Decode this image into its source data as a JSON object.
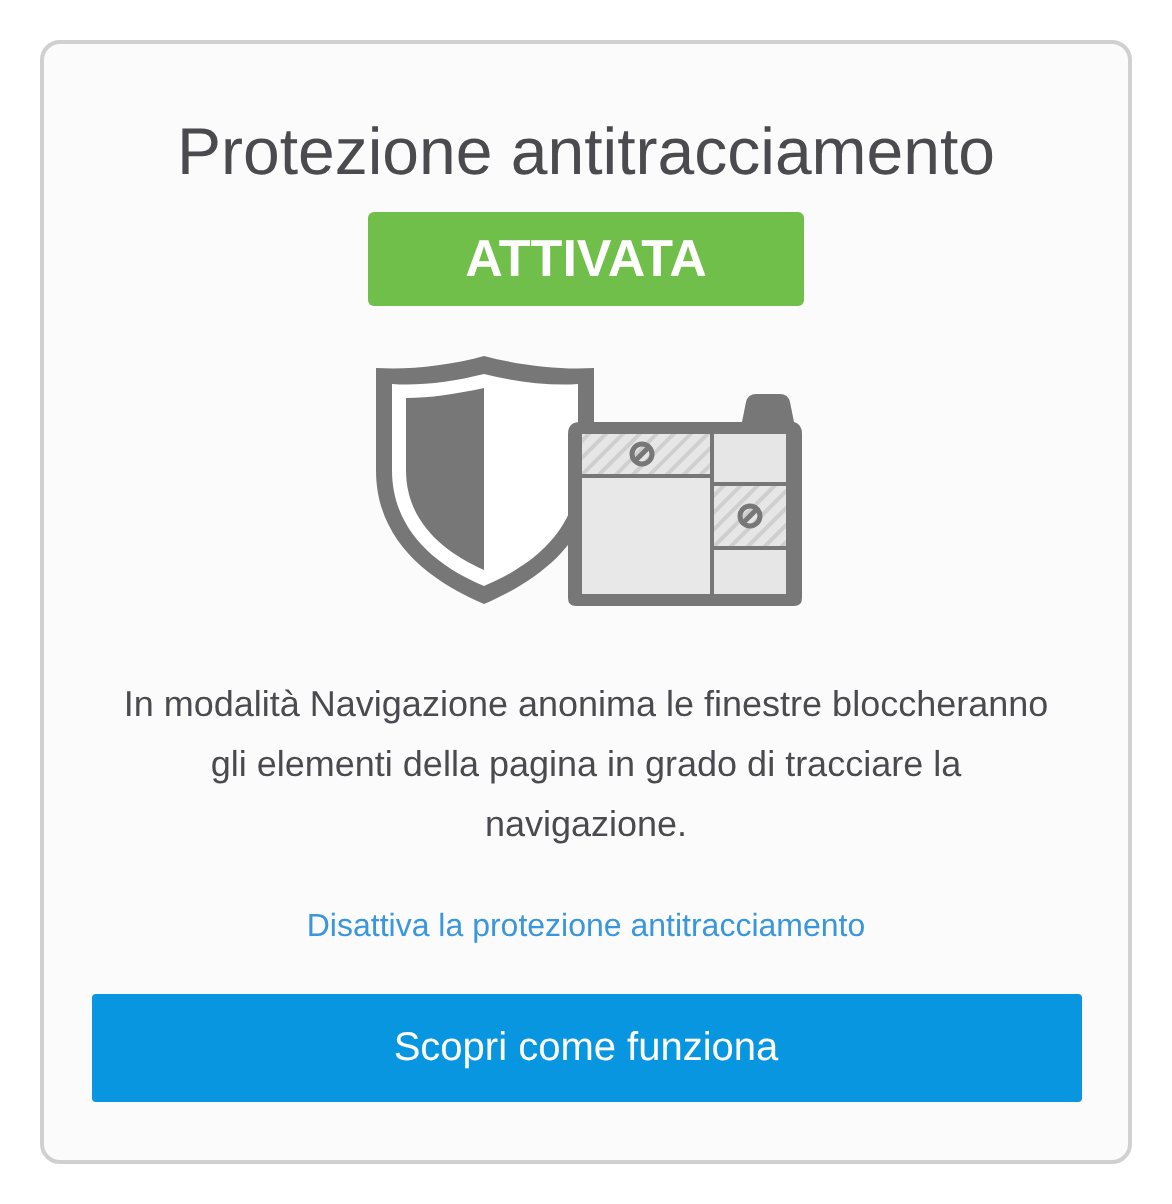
{
  "title": "Protezione antitracciamento",
  "status": {
    "label": "ATTIVATA",
    "on": true
  },
  "description": "In modalità Navigazione anonima le finestre bloccheranno gli elementi della pagina in grado di tracciare la navigazione.",
  "link": "Disattiva la protezione antitracciamento",
  "button": "Scopri come funziona"
}
